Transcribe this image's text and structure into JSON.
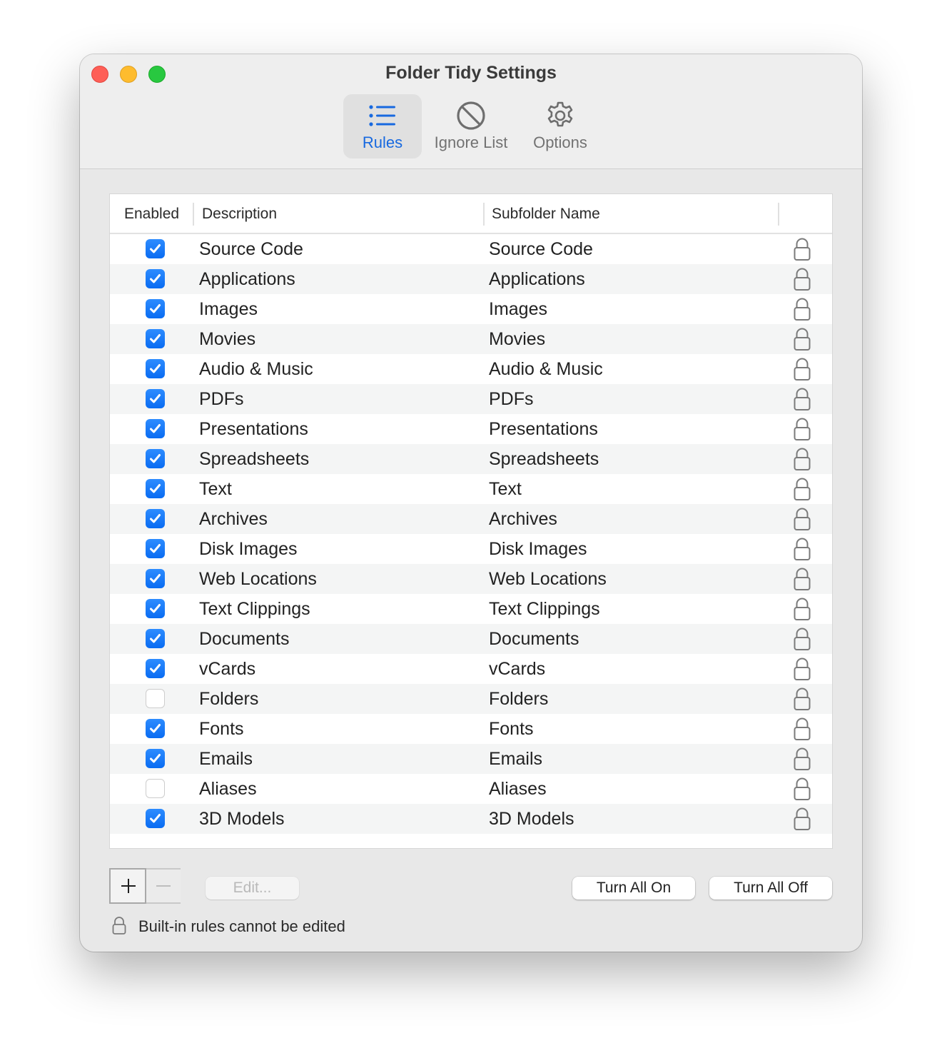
{
  "window": {
    "title": "Folder Tidy Settings",
    "traffic_lights": {
      "close": "#fe5f57",
      "minimize": "#febc2e",
      "zoom": "#28c840"
    }
  },
  "toolbar": {
    "items": [
      {
        "label": "Rules",
        "icon": "list-bullet-icon",
        "selected": true
      },
      {
        "label": "Ignore List",
        "icon": "prohibited-icon",
        "selected": false
      },
      {
        "label": "Options",
        "icon": "gear-icon",
        "selected": false
      }
    ],
    "accent": "#1769e0"
  },
  "table": {
    "columns": [
      "Enabled",
      "Description",
      "Subfolder Name",
      ""
    ],
    "rows": [
      {
        "enabled": true,
        "description": "Source Code",
        "subfolder": "Source Code",
        "locked": true
      },
      {
        "enabled": true,
        "description": "Applications",
        "subfolder": "Applications",
        "locked": true
      },
      {
        "enabled": true,
        "description": "Images",
        "subfolder": "Images",
        "locked": true
      },
      {
        "enabled": true,
        "description": "Movies",
        "subfolder": "Movies",
        "locked": true
      },
      {
        "enabled": true,
        "description": "Audio & Music",
        "subfolder": "Audio & Music",
        "locked": true
      },
      {
        "enabled": true,
        "description": "PDFs",
        "subfolder": "PDFs",
        "locked": true
      },
      {
        "enabled": true,
        "description": "Presentations",
        "subfolder": "Presentations",
        "locked": true
      },
      {
        "enabled": true,
        "description": "Spreadsheets",
        "subfolder": "Spreadsheets",
        "locked": true
      },
      {
        "enabled": true,
        "description": "Text",
        "subfolder": "Text",
        "locked": true
      },
      {
        "enabled": true,
        "description": "Archives",
        "subfolder": "Archives",
        "locked": true
      },
      {
        "enabled": true,
        "description": "Disk Images",
        "subfolder": "Disk Images",
        "locked": true
      },
      {
        "enabled": true,
        "description": "Web Locations",
        "subfolder": "Web Locations",
        "locked": true
      },
      {
        "enabled": true,
        "description": "Text Clippings",
        "subfolder": "Text Clippings",
        "locked": true
      },
      {
        "enabled": true,
        "description": "Documents",
        "subfolder": "Documents",
        "locked": true
      },
      {
        "enabled": true,
        "description": "vCards",
        "subfolder": "vCards",
        "locked": true
      },
      {
        "enabled": false,
        "description": "Folders",
        "subfolder": "Folders",
        "locked": true
      },
      {
        "enabled": true,
        "description": "Fonts",
        "subfolder": "Fonts",
        "locked": true
      },
      {
        "enabled": true,
        "description": "Emails",
        "subfolder": "Emails",
        "locked": true
      },
      {
        "enabled": false,
        "description": "Aliases",
        "subfolder": "Aliases",
        "locked": true
      },
      {
        "enabled": true,
        "description": "3D Models",
        "subfolder": "3D Models",
        "locked": true
      }
    ]
  },
  "controls": {
    "add_label": "+",
    "remove_label": "−",
    "edit_label": "Edit...",
    "turn_all_on_label": "Turn All On",
    "turn_all_off_label": "Turn All Off"
  },
  "footnote": "Built-in rules cannot be edited",
  "colors": {
    "checkbox_on": "#0a6cf2",
    "row_alt": "#f4f5f5",
    "lock_stroke": "#7a7a7a"
  }
}
